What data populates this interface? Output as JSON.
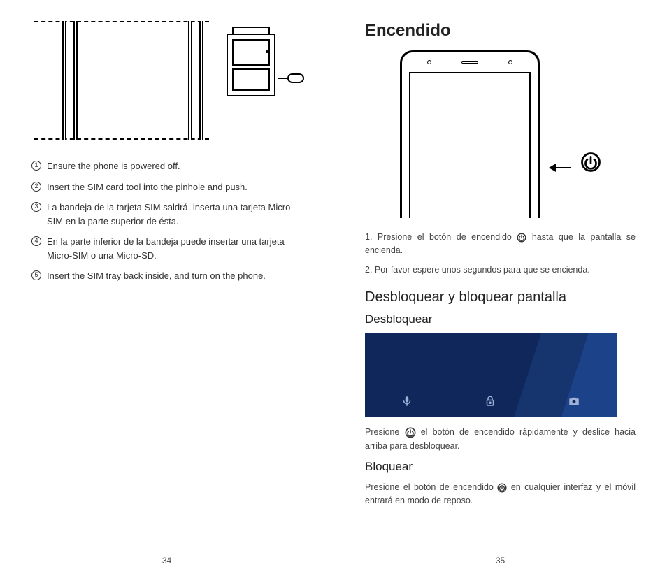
{
  "left": {
    "steps": [
      {
        "n": "1",
        "text": "Ensure the phone is powered off."
      },
      {
        "n": "2",
        "text": "Insert the SIM card tool into the pinhole and push."
      },
      {
        "n": "3",
        "text": "La bandeja de la tarjeta SIM saldrá, inserta una tarjeta Micro-SIM en la parte superior de ésta."
      },
      {
        "n": "4",
        "text": "En la parte inferior de la bandeja puede insertar una tarjeta Micro-SIM o una Micro-SD."
      },
      {
        "n": "5",
        "text": "Insert the SIM tray back inside, and turn on the phone."
      }
    ],
    "page_num": "34"
  },
  "right": {
    "h_encendido": "Encendido",
    "enc_step1_a": "1. Presione el botón de encendido",
    "enc_step1_b": "hasta que la pantalla se encienda.",
    "enc_step2": "2. Por favor espere unos segundos para que se encienda.",
    "h_desbloq_bloq": "Desbloquear y bloquear pantalla",
    "h_desbloq": "Desbloquear",
    "desbloq_a": "Presione ",
    "desbloq_b": " el botón de encendido rápidamente y deslice hacia arriba para desbloquear.",
    "h_bloq": "Bloquear",
    "bloq_a": "Presione el botón de encendido ",
    "bloq_b": " en cualquier interfaz y el móvil entrará en modo de reposo.",
    "page_num": "35"
  },
  "icons": {
    "power": "power-icon",
    "mic": "mic-icon",
    "lock": "lock-icon",
    "camera": "camera-icon"
  }
}
